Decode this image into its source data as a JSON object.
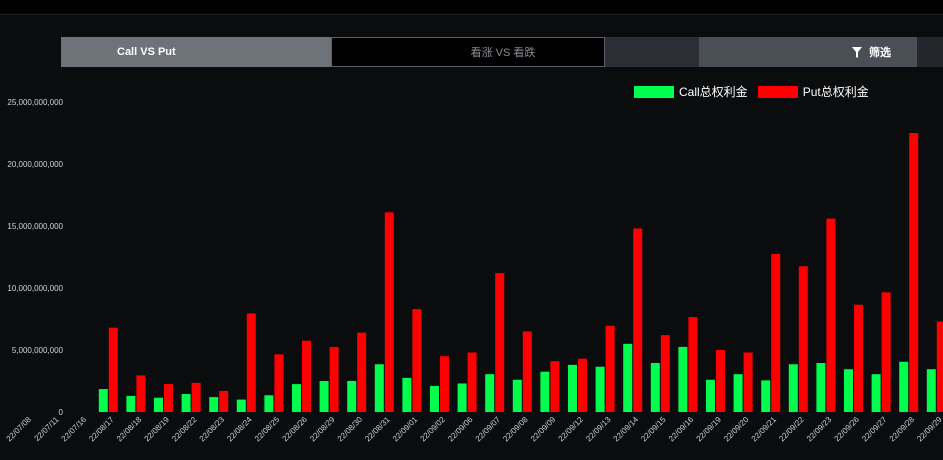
{
  "tabs": {
    "call_vs_put": "Call VS Put",
    "rise_vs_fall": "看涨 VS 看跌",
    "filter": "筛选"
  },
  "colors": {
    "call": "#00ff4c",
    "put": "#ff0000",
    "background": "#0b0c0e"
  },
  "chart_data": {
    "type": "bar",
    "categories": [
      "22/07/08",
      "22/07/11",
      "22/07/16",
      "22/08/17",
      "22/08/18",
      "22/08/19",
      "22/08/22",
      "22/08/23",
      "22/08/24",
      "22/08/25",
      "22/08/26",
      "22/08/29",
      "22/08/30",
      "22/08/31",
      "22/09/01",
      "22/09/02",
      "22/09/06",
      "22/09/07",
      "22/09/08",
      "22/09/09",
      "22/09/12",
      "22/09/13",
      "22/09/14",
      "22/09/15",
      "22/09/16",
      "22/09/19",
      "22/09/20",
      "22/09/21",
      "22/09/22",
      "22/09/23",
      "22/09/26",
      "22/09/27",
      "22/09/28",
      "22/09/29"
    ],
    "series": [
      {
        "name": "Call总权利金",
        "color": "#00ff4c",
        "values": [
          0,
          0,
          0,
          1850000000,
          1300000000,
          1150000000,
          1450000000,
          1200000000,
          1000000000,
          1350000000,
          2250000000,
          2500000000,
          2500000000,
          3850000000,
          2750000000,
          2100000000,
          2300000000,
          3050000000,
          2600000000,
          3250000000,
          3800000000,
          3650000000,
          5500000000,
          3950000000,
          5250000000,
          2600000000,
          3050000000,
          2550000000,
          3850000000,
          3950000000,
          3450000000,
          3050000000,
          4050000000,
          3450000000
        ]
      },
      {
        "name": "Put总权利金",
        "color": "#ff0000",
        "values": [
          0,
          0,
          0,
          6800000000,
          2950000000,
          2250000000,
          2350000000,
          1700000000,
          7950000000,
          4650000000,
          5750000000,
          5250000000,
          6400000000,
          16100000000,
          8300000000,
          4500000000,
          4800000000,
          11200000000,
          6500000000,
          4100000000,
          4300000000,
          6950000000,
          14800000000,
          6200000000,
          7650000000,
          5000000000,
          4800000000,
          12750000000,
          11750000000,
          15600000000,
          8650000000,
          9650000000,
          22500000000,
          7300000000
        ]
      }
    ],
    "y_ticks": [
      "0",
      "5,000,000,000",
      "10,000,000,000",
      "15,000,000,000",
      "20,000,000,000",
      "25,000,000,000"
    ],
    "ylim": [
      0,
      25000000000
    ],
    "legend": "top-right",
    "grid": false
  }
}
